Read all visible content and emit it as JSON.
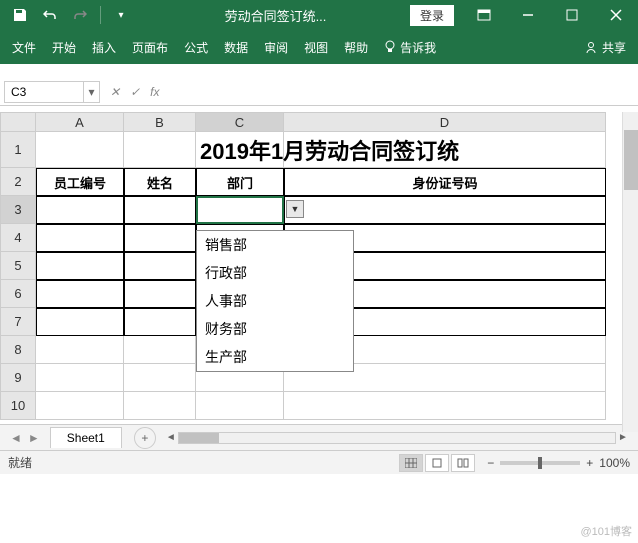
{
  "titlebar": {
    "doc_title": "劳动合同签订统...",
    "login": "登录"
  },
  "ribbon": {
    "tabs": [
      "文件",
      "开始",
      "插入",
      "页面布",
      "公式",
      "数据",
      "审阅",
      "视图",
      "帮助"
    ],
    "tell_me": "告诉我",
    "share": "共享"
  },
  "formula": {
    "name_box": "C3",
    "fx": "fx"
  },
  "columns": [
    "A",
    "B",
    "C",
    "D"
  ],
  "rows": [
    "1",
    "2",
    "3",
    "4",
    "5",
    "6",
    "7",
    "8",
    "9",
    "10"
  ],
  "sheet": {
    "title": "2019年1月劳动合同签订统",
    "headers": {
      "a": "员工编号",
      "b": "姓名",
      "c": "部门",
      "d": "身份证号码"
    }
  },
  "dropdown": {
    "items": [
      "销售部",
      "行政部",
      "人事部",
      "财务部",
      "生产部"
    ]
  },
  "tabs": {
    "sheet1": "Sheet1"
  },
  "status": {
    "ready": "就绪",
    "zoom": "100%"
  },
  "watermark": "@101博客",
  "chart_data": {
    "type": "table",
    "title": "2019年1月劳动合同签订统",
    "columns": [
      "员工编号",
      "姓名",
      "部门",
      "身份证号码"
    ],
    "rows": [],
    "validation_list_column_C": [
      "销售部",
      "行政部",
      "人事部",
      "财务部",
      "生产部"
    ]
  }
}
